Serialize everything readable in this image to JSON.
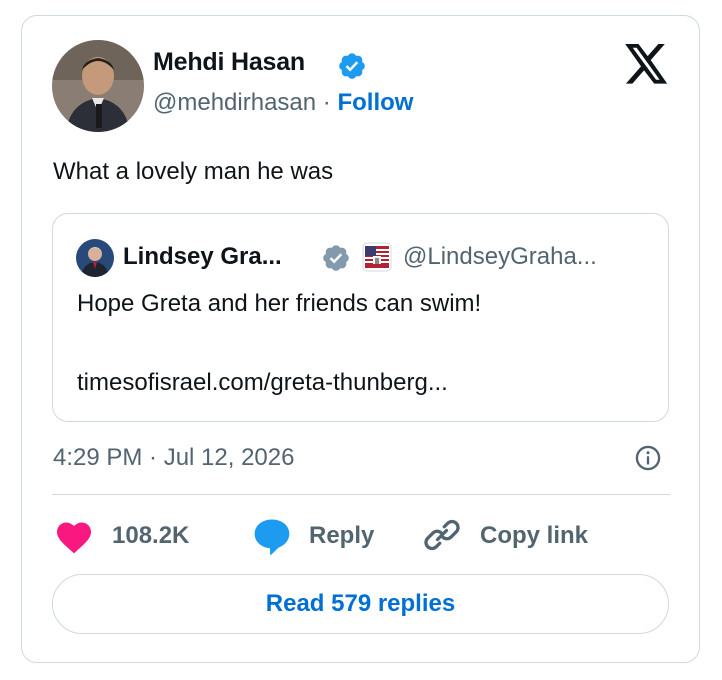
{
  "author": {
    "name": "Mehdi Hasan",
    "handle": "@mehdirhasan",
    "separator": " · ",
    "follow_label": "Follow",
    "verified": true
  },
  "tweet": {
    "text": "What a lovely man he was",
    "timestamp": "4:29 PM · Jul 12, 2026"
  },
  "quoted_tweet": {
    "name": "Lindsey Gra...",
    "handle": "@LindseyGraha...",
    "text": "Hope Greta and her friends can swim!",
    "link": "timesofisrael.com/greta-thunberg..."
  },
  "actions": {
    "likes": "108.2K",
    "reply_label": "Reply",
    "copy_link_label": "Copy link",
    "read_replies_label": "Read 579 replies"
  },
  "colors": {
    "accent": "#006fd6",
    "verified": "#1d9bf0",
    "like": "#f91880",
    "muted": "#536471",
    "border": "#cfd9de"
  },
  "icons": [
    "verified-badge-icon",
    "x-logo-icon",
    "flag-icon",
    "info-icon",
    "heart-icon",
    "reply-bubble-icon",
    "link-icon"
  ]
}
